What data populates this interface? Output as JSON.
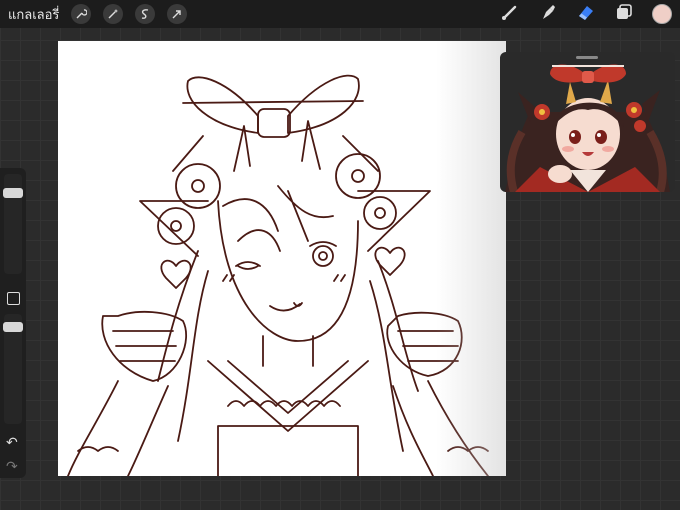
{
  "topbar": {
    "gallery_label": "แกลเลอรี่",
    "left_tools": [
      "wrench-icon",
      "magic-wand-icon",
      "selection-icon",
      "transform-arrow-icon"
    ],
    "right_tools": [
      "brush-icon",
      "smudge-icon",
      "eraser-icon",
      "layers-icon"
    ],
    "current_color": "#efcfc7",
    "active_tool_color": "#3a7ef5"
  },
  "sidebar": {
    "brush_size_level": 0.85,
    "opacity_level": 0.9,
    "undo_icon": "undo-icon",
    "redo_icon": "redo-icon"
  },
  "canvas": {
    "line_color": "#4a1a14",
    "background": "#ffffff"
  },
  "reference": {
    "hair_color": "#3a2320",
    "ribbon_color": "#c0392b",
    "skin_color": "#f6dcd0"
  }
}
